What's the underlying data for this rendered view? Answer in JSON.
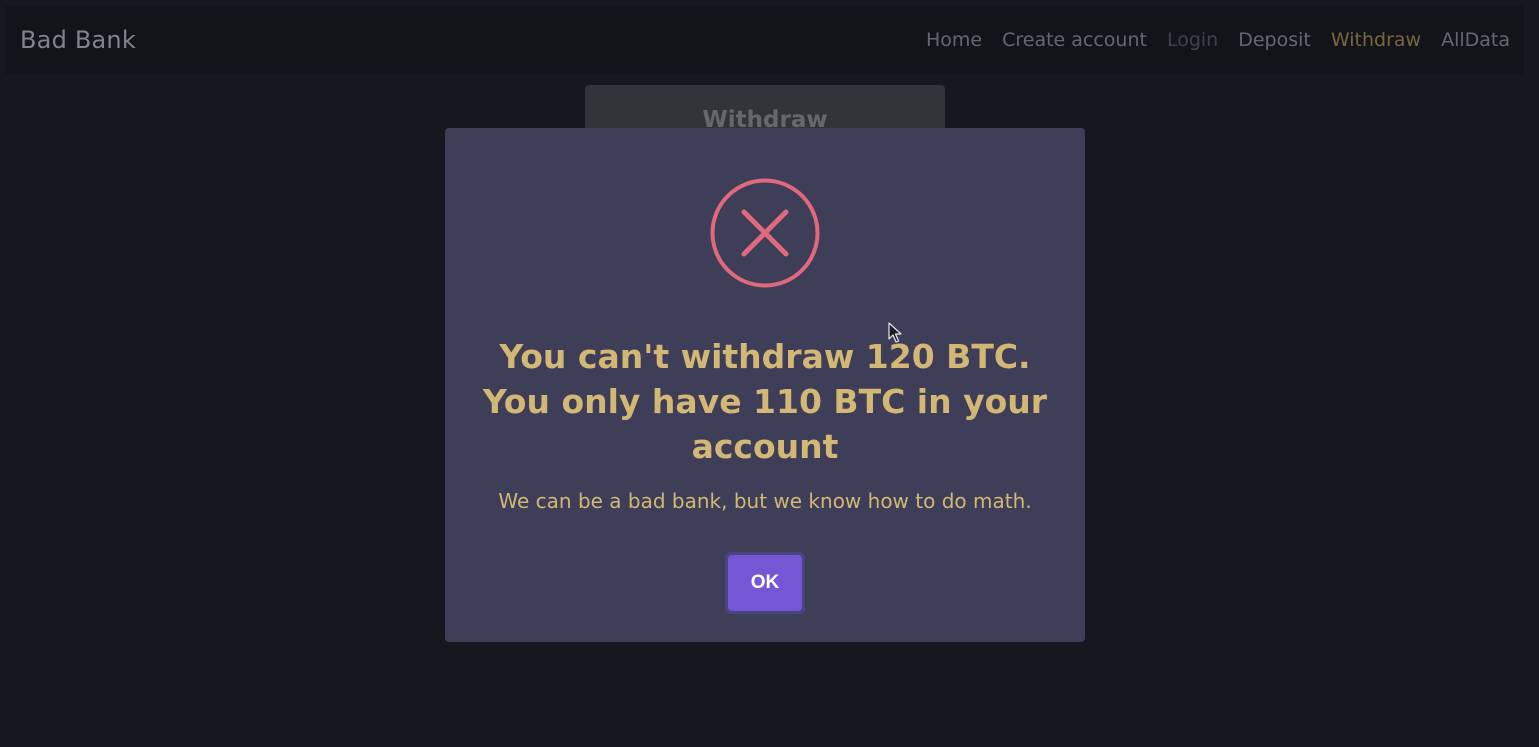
{
  "navbar": {
    "brand": "Bad Bank",
    "links": [
      {
        "label": "Home"
      },
      {
        "label": "Create account"
      },
      {
        "label": "Login"
      },
      {
        "label": "Deposit"
      },
      {
        "label": "Withdraw"
      },
      {
        "label": "AllData"
      }
    ]
  },
  "background_card": {
    "title": "Withdraw"
  },
  "modal": {
    "icon": "error-x-icon",
    "title": "You can't withdraw 120 BTC. You only have 110 BTC in your account",
    "text": "We can be a bad bank, but we know how to do math.",
    "ok_label": "OK"
  },
  "colors": {
    "background": "#181b23",
    "navbar": "#14161b",
    "modal": "#3e3e58",
    "accent_gold": "#d3b775",
    "error_red": "#e06a7b",
    "button_purple": "#7557d6"
  }
}
